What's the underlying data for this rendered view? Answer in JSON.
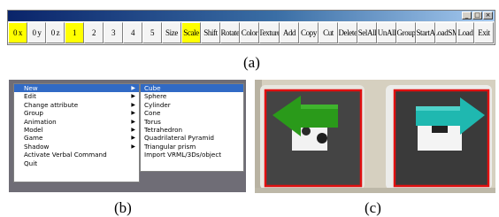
{
  "panel_a": {
    "toolbar_buttons": [
      {
        "label": "0 x",
        "highlight": true
      },
      {
        "label": "0 y",
        "highlight": false
      },
      {
        "label": "0 z",
        "highlight": false
      },
      {
        "label": "1",
        "highlight": true
      },
      {
        "label": "2",
        "highlight": false
      },
      {
        "label": "3",
        "highlight": false
      },
      {
        "label": "4",
        "highlight": false
      },
      {
        "label": "5",
        "highlight": false
      },
      {
        "label": "Size",
        "highlight": false
      },
      {
        "label": "Scale",
        "highlight": true
      },
      {
        "label": "Shift",
        "highlight": false
      },
      {
        "label": "Rotate",
        "highlight": false
      },
      {
        "label": "Color",
        "highlight": false
      },
      {
        "label": "Texture",
        "highlight": false
      },
      {
        "label": "Add",
        "highlight": false
      },
      {
        "label": "Copy",
        "highlight": false
      },
      {
        "label": "Cut",
        "highlight": false
      },
      {
        "label": "Delete",
        "highlight": false
      },
      {
        "label": "SelAll",
        "highlight": false
      },
      {
        "label": "UnAll",
        "highlight": false
      },
      {
        "label": "Group",
        "highlight": false
      },
      {
        "label": "StartA",
        "highlight": false
      },
      {
        "label": "LoadSM",
        "highlight": false
      },
      {
        "label": "Load",
        "highlight": false
      },
      {
        "label": "Exit",
        "highlight": false
      }
    ],
    "caption": "(a)"
  },
  "panel_b": {
    "main_menu": [
      "New",
      "Edit",
      "Change attribute",
      "Group",
      "Animation",
      "Model",
      "Game",
      "Shadow",
      "Activate Verbal Command",
      "Quit"
    ],
    "main_menu_arrows": [
      true,
      true,
      true,
      true,
      true,
      true,
      true,
      true,
      false,
      false
    ],
    "submenu": [
      "Cube",
      "Sphere",
      "Cylinder",
      "Cone",
      "Torus",
      "Tetrahedron",
      "Quadrilateral Pyramid",
      "Triangular prism",
      "Import VRML/3Ds/object"
    ],
    "caption": "(b)"
  },
  "panel_c": {
    "caption": "(c)",
    "colors": {
      "left_arrow": "#2a9a1a",
      "right_arrow": "#1fb8b0",
      "marker_frame": "#e01010",
      "marker_fill": "#3a3a3a"
    }
  },
  "colors": {
    "highlight_yellow": "#ffff00",
    "menu_selection": "#316ac5"
  }
}
